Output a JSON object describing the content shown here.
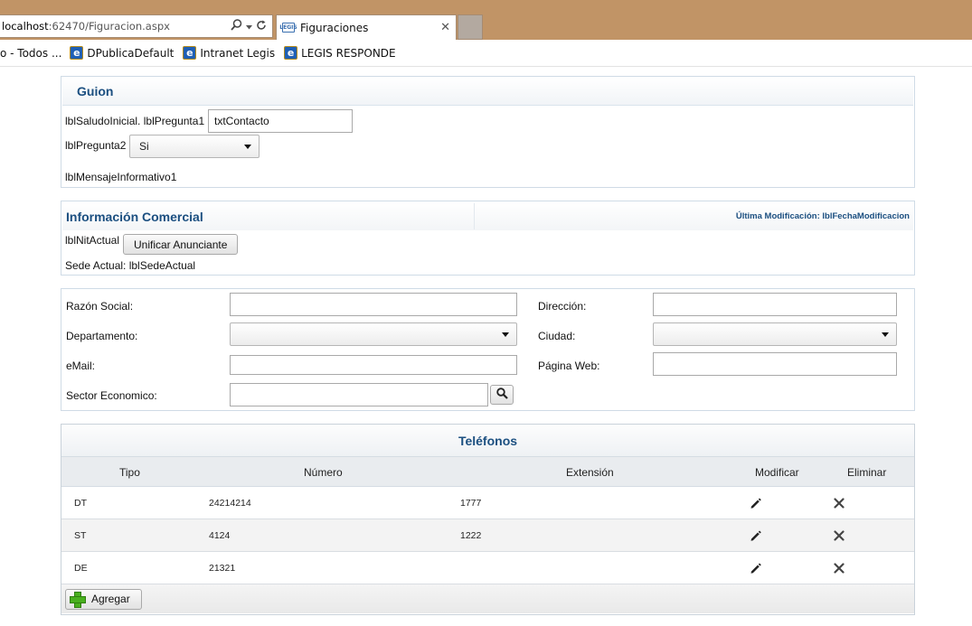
{
  "browser": {
    "address_host": "localhost",
    "address_path": ":62470/Figuracion.aspx",
    "tab_title": "Figuraciones",
    "tab_favicon_text": "LEGIS",
    "favorites": [
      {
        "label": "o - Todos ..."
      },
      {
        "label": "DPublicaDefault"
      },
      {
        "label": "Intranet Legis"
      },
      {
        "label": "LEGIS RESPONDE"
      }
    ]
  },
  "guion": {
    "title": "Guion",
    "saludo_label": "lblSaludoInicial.",
    "pregunta1_label": "lblPregunta1",
    "contacto_value": "txtContacto",
    "pregunta2_label": "lblPregunta2",
    "pregunta2_value": "Si",
    "mensaje_label": "lblMensajeInformativo1"
  },
  "comercial": {
    "title": "Información Comercial",
    "ultima_mod": "Última Modificación: lblFechaModificacion",
    "nit_label": "lblNitActual",
    "unificar_button": "Unificar Anunciante",
    "sede_label": "Sede Actual: lblSedeActual"
  },
  "form": {
    "razon_social_label": "Razón Social:",
    "razon_social_value": "",
    "direccion_label": "Dirección:",
    "direccion_value": "",
    "departamento_label": "Departamento:",
    "departamento_value": "",
    "ciudad_label": "Ciudad:",
    "ciudad_value": "",
    "email_label": "eMail:",
    "email_value": "",
    "web_label": "Página Web:",
    "web_value": "",
    "sector_label": "Sector Economico:",
    "sector_value": ""
  },
  "telefonos": {
    "title": "Teléfonos",
    "columns": {
      "tipo": "Tipo",
      "numero": "Número",
      "extension": "Extensión",
      "modificar": "Modificar",
      "eliminar": "Eliminar"
    },
    "rows": [
      {
        "tipo": "DT",
        "numero": "24214214",
        "extension": "1777"
      },
      {
        "tipo": "ST",
        "numero": "4124",
        "extension": "1222"
      },
      {
        "tipo": "DE",
        "numero": "21321",
        "extension": ""
      }
    ],
    "add_button": "Agregar"
  },
  "colors": {
    "chrome": "#c19466",
    "title_blue": "#1b4f80",
    "add_green": "#49b01f"
  }
}
